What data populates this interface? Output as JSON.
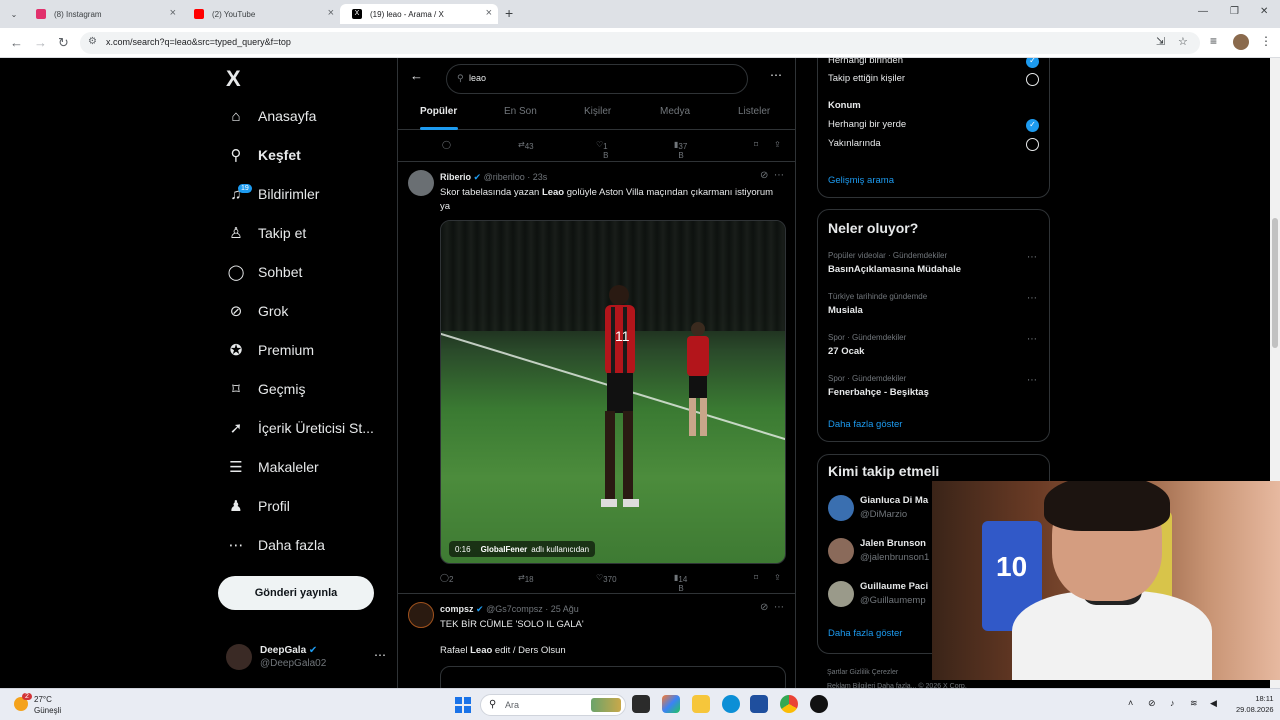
{
  "browser": {
    "tabs": [
      {
        "title": "(8) Instagram",
        "color": "#e1306c"
      },
      {
        "title": "(2) YouTube",
        "color": "#ff0000"
      },
      {
        "title": "(19) leao - Arama / X",
        "color": "#000000"
      }
    ],
    "url": "x.com/search?q=leao&src=typed_query&f=top"
  },
  "nav": {
    "logo": "X",
    "items": [
      {
        "label": "Anasayfa",
        "icon": "home-icon"
      },
      {
        "label": "Keşfet",
        "icon": "search-icon"
      },
      {
        "label": "Bildirimler",
        "icon": "bell-icon",
        "badge": "19"
      },
      {
        "label": "Takip et",
        "icon": "person-add-icon"
      },
      {
        "label": "Sohbet",
        "icon": "chat-icon"
      },
      {
        "label": "Grok",
        "icon": "grok-icon"
      },
      {
        "label": "Premium",
        "icon": "premium-icon"
      },
      {
        "label": "Geçmiş",
        "icon": "bookmark-icon"
      },
      {
        "label": "İçerik Üreticisi St...",
        "icon": "rocket-icon"
      },
      {
        "label": "Makaleler",
        "icon": "article-icon"
      },
      {
        "label": "Profil",
        "icon": "profile-icon"
      },
      {
        "label": "Daha fazla",
        "icon": "more-circle-icon"
      }
    ],
    "post_button": "Gönderi yayınla",
    "me": {
      "name": "DeepGala",
      "handle": "@DeepGala02"
    }
  },
  "search": {
    "query": "leao",
    "tabs": [
      "Popüler",
      "En Son",
      "Kişiler",
      "Medya",
      "Listeler"
    ],
    "active_tab": "Popüler"
  },
  "top_actions": {
    "replies": "",
    "reposts": "43",
    "likes": "1 B",
    "views": "37 B"
  },
  "tweets": [
    {
      "name": "Riberio",
      "handle": "@riberiloo",
      "time": "23s",
      "text_pre": "Skor tabelasında yazan ",
      "text_bold": "Leao",
      "text_post": " golüyle Aston Villa maçından çıkarmanı istiyorum ya",
      "video": {
        "duration": "0:16",
        "by": "GlobalFener",
        "by_suffix": "adlı kullanıcıdan",
        "jersey": "11"
      },
      "actions": {
        "replies": "2",
        "reposts": "18",
        "likes": "370",
        "views": "14 B"
      }
    },
    {
      "name": "compsz",
      "handle": "@Gs7compsz",
      "time": "25 Ağu",
      "line1": "TEK BİR CÜMLE 'SOLO IL GALA'",
      "line2_pre": "Rafael ",
      "line2_bold": "Leao",
      "line2_post": " edit / Ders Olsun"
    }
  ],
  "right": {
    "filters": {
      "people_opt1": "Herhangi birinden",
      "people_opt2": "Takip ettiğin kişiler",
      "location_head": "Konum",
      "loc_opt1": "Herhangi bir yerde",
      "loc_opt2": "Yakınlarında",
      "advanced": "Gelişmiş arama"
    },
    "trends_title": "Neler oluyor?",
    "trends": [
      {
        "meta": "Popüler videolar · Gündemdekiler",
        "title": "BasınAçıklamasına Müdahale"
      },
      {
        "meta": "Türkiye tarihinde gündemde",
        "title": "Musiala"
      },
      {
        "meta": "Spor · Gündemdekiler",
        "title": "27 Ocak"
      },
      {
        "meta": "Spor · Gündemdekiler",
        "title": "Fenerbahçe - Beşiktaş"
      }
    ],
    "show_more": "Daha fazla göster",
    "who_title": "Kimi takip etmeli",
    "who": [
      {
        "name": "Gianluca Di Ma",
        "handle": "@DiMarzio"
      },
      {
        "name": "Jalen Brunson",
        "handle": "@jalenbrunson1"
      },
      {
        "name": "Guillaume Paci",
        "handle": "@Guillaumemp"
      }
    ],
    "who_more": "Daha fazla göster",
    "footer1": "Şartlar   Gizlilik   Çerezler",
    "footer2": "Reklam Bilgileri   Daha fazla...   © 2026 X Corp."
  },
  "cam": {
    "jersey_number": "10"
  },
  "taskbar": {
    "weather_badge": "2",
    "temp": "27°C",
    "condition": "Güneşli",
    "search_placeholder": "Ara",
    "time": "18:11",
    "date": "29.08.2026"
  }
}
